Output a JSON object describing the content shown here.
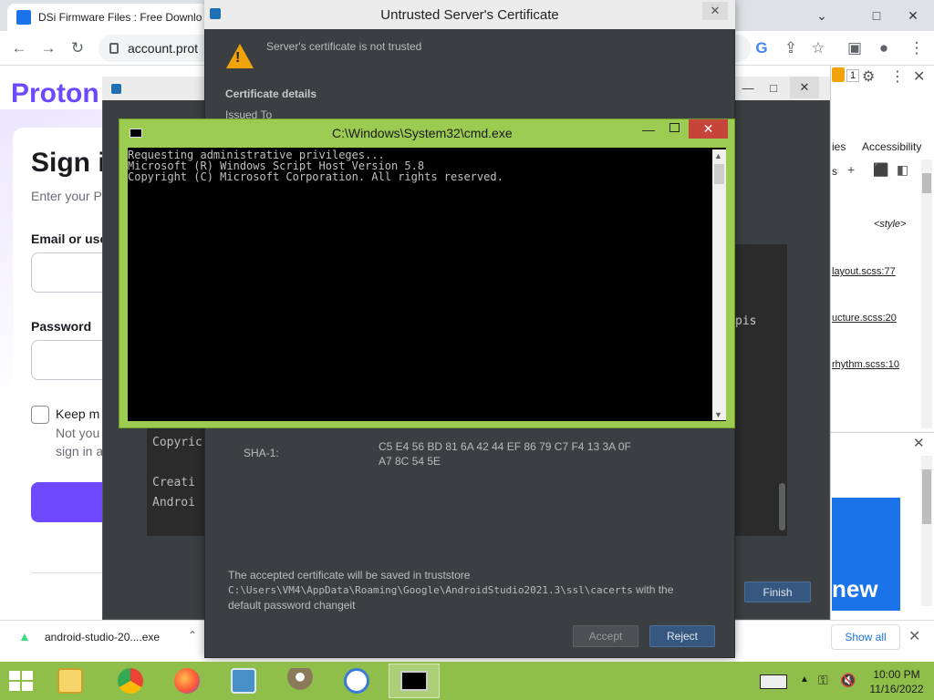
{
  "browser": {
    "tab_title": "DSi Firmware Files : Free Downlo",
    "url": "account.prot",
    "win_min": "⌄",
    "win_max": "□",
    "win_close": "✕"
  },
  "proton_page": {
    "logo": "Proton",
    "title": "Sign i",
    "subtitle": "Enter your P",
    "email_label": "Email or use",
    "password_label": "Password",
    "keep_label": "Keep m",
    "not_your": "Not you",
    "sign_in_a": "sign in a"
  },
  "devtools": {
    "tab_dies": "ies",
    "tab_accessibility": "Accessibility",
    "badge": "1",
    "style_tag": "<style>",
    "link1": "layout.scss:77",
    "link2": "ucture.scss:20",
    "link3": "rhythm.scss:10",
    "ad_text": "new"
  },
  "downloads": {
    "filename": "android-studio-20....exe",
    "show_all": "Show all"
  },
  "android_studio": {
    "console_copyright": "Copyric",
    "console_creating": "Creati",
    "console_android": "Androi",
    "right_text": "pis",
    "finish": "Finish"
  },
  "cert_dialog": {
    "title": "Untrusted Server's Certificate",
    "warning": "Server's certificate is not trusted",
    "details_heading": "Certificate details",
    "issued_to": "Issued To",
    "sha1_label": "SHA-1:",
    "sha1_line1": "C5 E4 56 BD 81 6A 42 44 EF 86 79 C7 F4 13 3A 0F",
    "sha1_line2": "A7 8C 54 5E",
    "note_line1": "The accepted certificate will be saved in truststore",
    "note_path": "C:\\Users\\VM4\\AppData\\Roaming\\Google\\AndroidStudio2021.3\\ssl\\cacerts",
    "note_with": " with the",
    "note_line3": "default password changeit",
    "accept": "Accept",
    "reject": "Reject"
  },
  "cmd": {
    "title": "C:\\Windows\\System32\\cmd.exe",
    "lines": [
      "Requesting administrative privileges...",
      "Microsoft (R) Windows Script Host Version 5.8",
      "Copyright (C) Microsoft Corporation. All rights reserved."
    ]
  },
  "taskbar": {
    "time": "10:00 PM",
    "date": "11/16/2022"
  },
  "colors": {
    "taskbar": "#8fbe4a",
    "cmd_frame": "#9ccb52",
    "proton_purple": "#6d4aff",
    "darcula_bg": "#3c3f41",
    "reject_blue": "#365880"
  }
}
